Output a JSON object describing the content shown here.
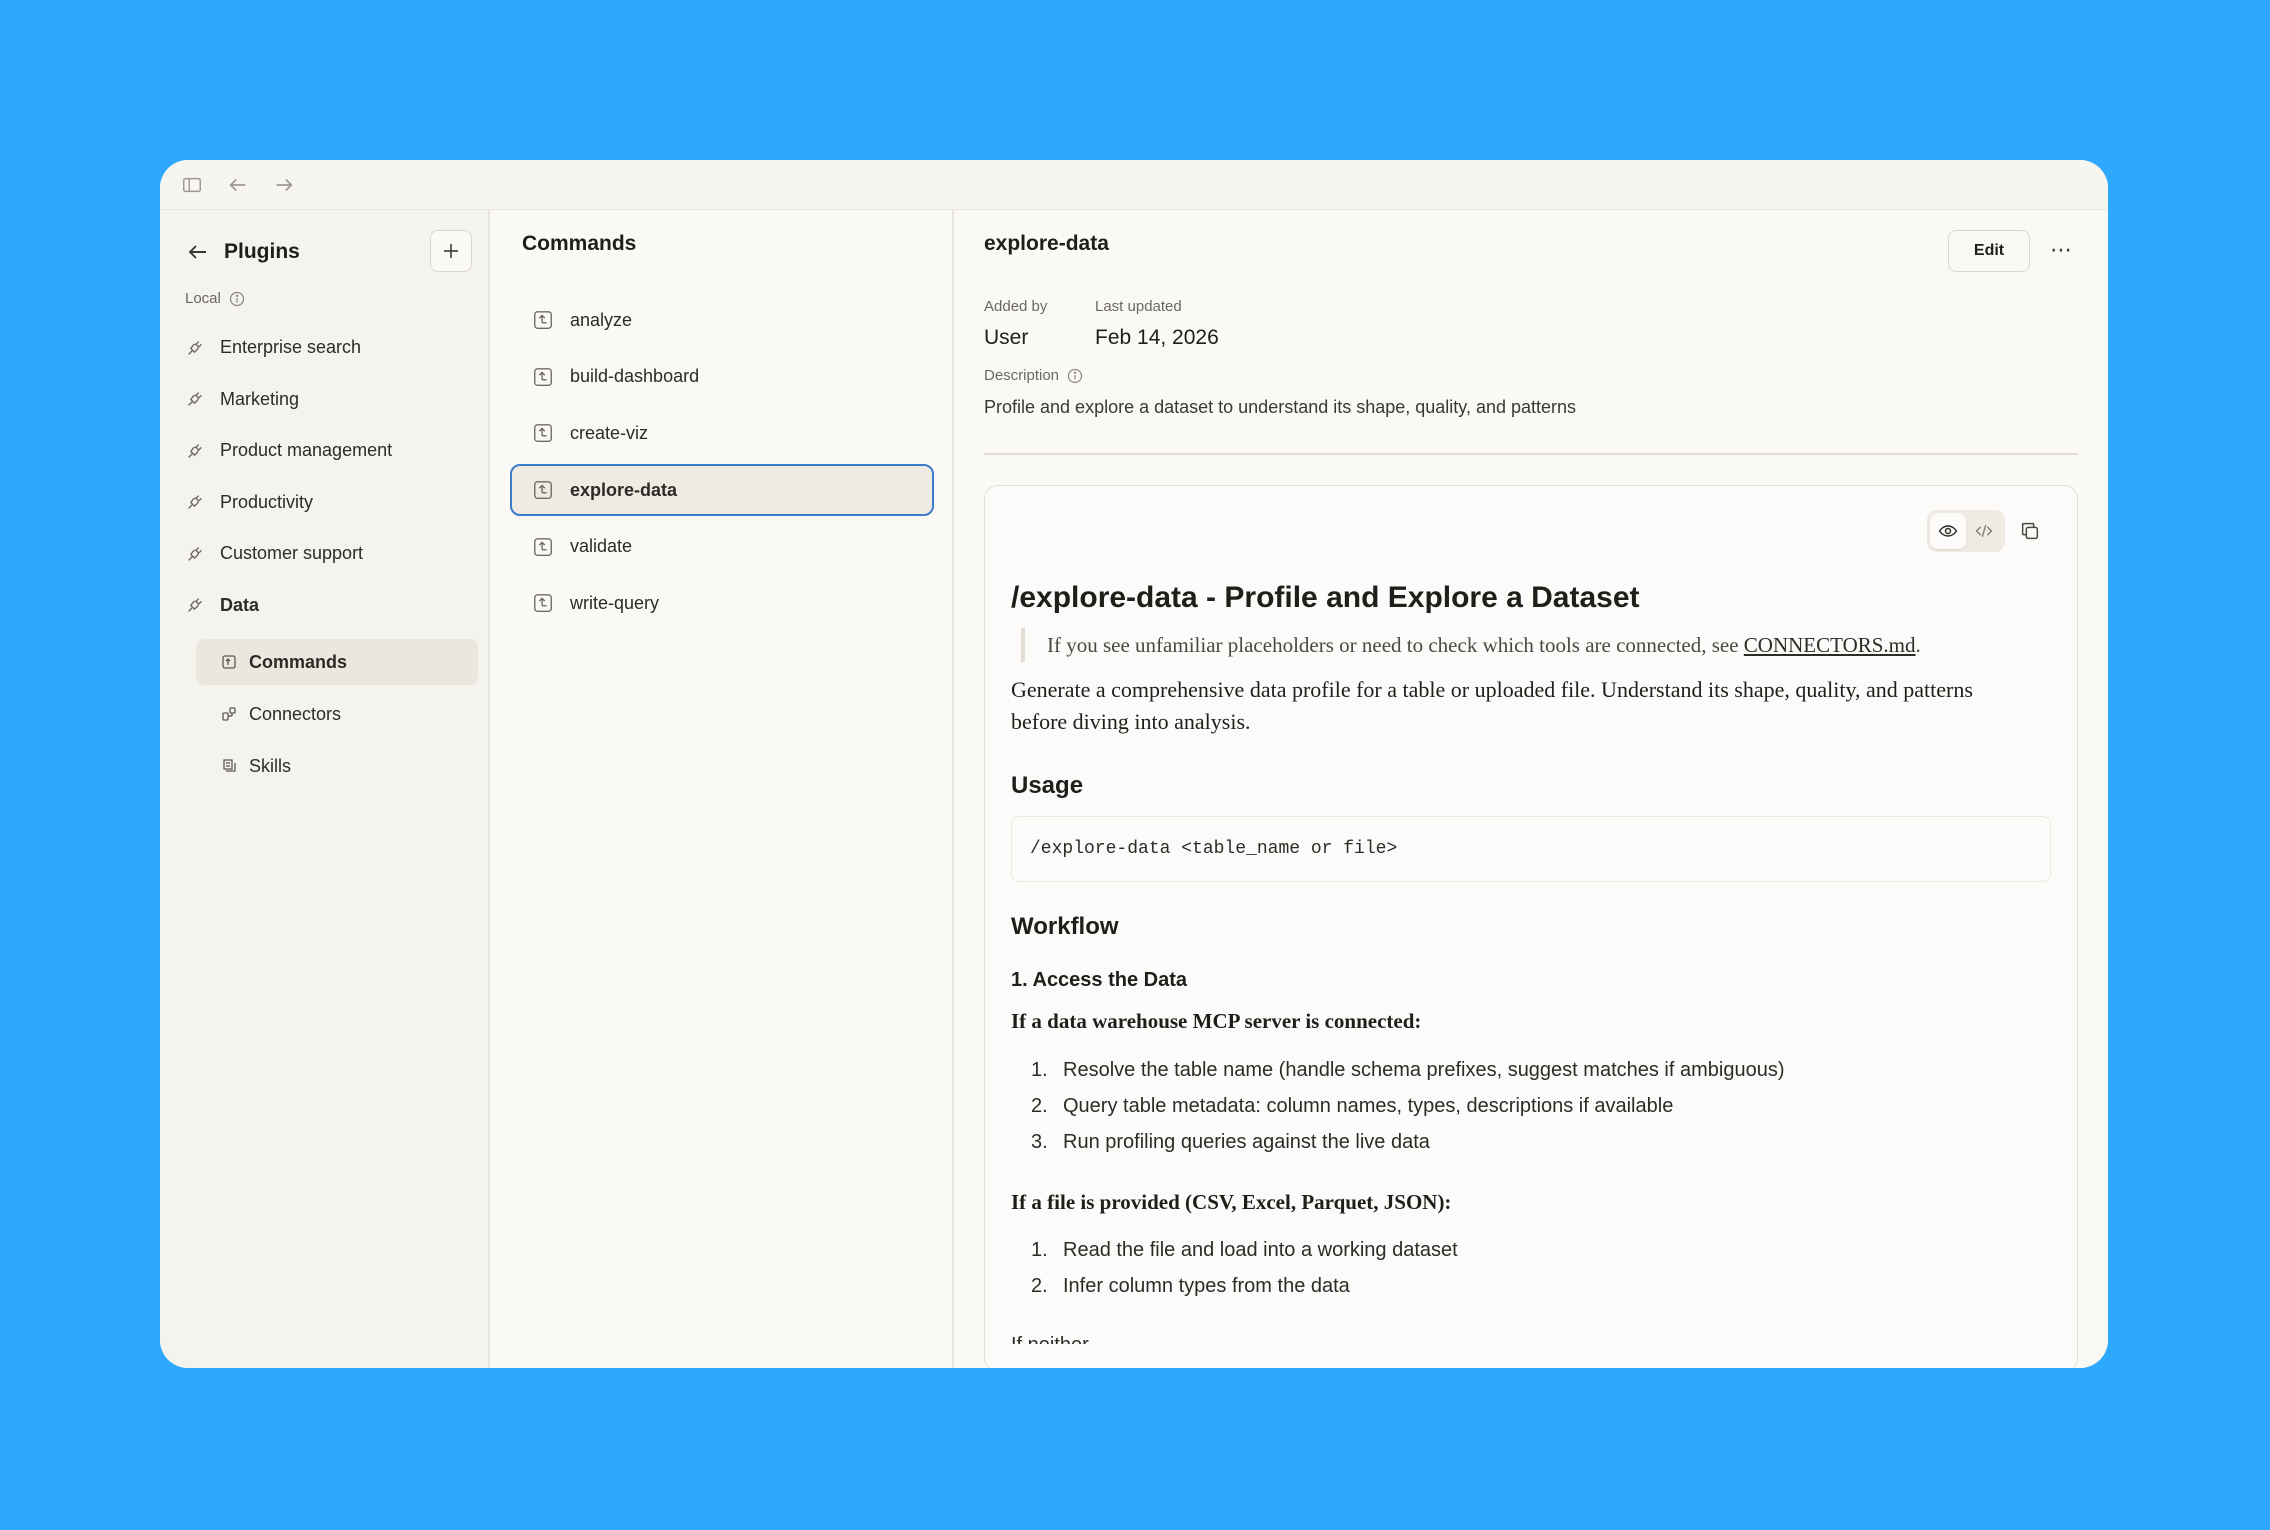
{
  "sidebar": {
    "title": "Plugins",
    "section_label": "Local",
    "items": [
      {
        "label": "Enterprise search"
      },
      {
        "label": "Marketing"
      },
      {
        "label": "Product management"
      },
      {
        "label": "Productivity"
      },
      {
        "label": "Customer support"
      },
      {
        "label": "Data"
      }
    ],
    "sub_items": [
      {
        "label": "Commands",
        "active": true
      },
      {
        "label": "Connectors"
      },
      {
        "label": "Skills"
      }
    ]
  },
  "commands": {
    "title": "Commands",
    "items": [
      {
        "label": "analyze"
      },
      {
        "label": "build-dashboard"
      },
      {
        "label": "create-viz"
      },
      {
        "label": "explore-data",
        "active": true
      },
      {
        "label": "validate"
      },
      {
        "label": "write-query"
      }
    ]
  },
  "detail": {
    "title": "explore-data",
    "edit_label": "Edit",
    "more_label": "⋯",
    "added_by_label": "Added by",
    "added_by_value": "User",
    "last_updated_label": "Last updated",
    "last_updated_value": "Feb 14, 2026",
    "description_label": "Description",
    "description_value": "Profile and explore a dataset to understand its shape, quality, and patterns"
  },
  "doc": {
    "h1": "/explore-data - Profile and Explore a Dataset",
    "quote_prefix": "If you see unfamiliar placeholders or need to check which tools are connected, see ",
    "quote_link": "CONNECTORS.md",
    "quote_suffix": ".",
    "intro": "Generate a comprehensive data profile for a table or uploaded file. Understand its shape, quality, and patterns before diving into analysis.",
    "usage_heading": "Usage",
    "usage_code": "/explore-data <table_name or file>",
    "workflow_heading": "Workflow",
    "step1_heading": "1. Access the Data",
    "warehouse_heading": "If a data warehouse MCP server is connected:",
    "warehouse_steps": [
      "Resolve the table name (handle schema prefixes, suggest matches if ambiguous)",
      "Query table metadata: column names, types, descriptions if available",
      "Run profiling queries against the live data"
    ],
    "file_heading": "If a file is provided (CSV, Excel, Parquet, JSON):",
    "file_steps": [
      "Read the file and load into a working dataset",
      "Infer column types from the data"
    ],
    "next_partial": "If neither"
  },
  "colors": {
    "background": "#2ea8fd",
    "window": "#faf9f6",
    "selection_border": "#3c7ccb"
  }
}
